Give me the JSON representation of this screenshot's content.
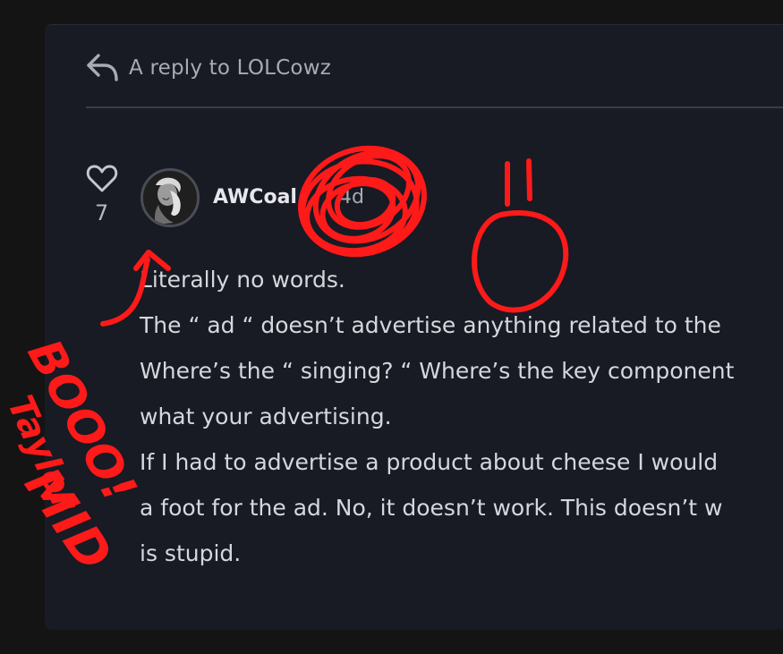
{
  "reply_header": {
    "text": "A reply to LOLCowz",
    "icon": "reply-arrow-icon"
  },
  "post": {
    "likes": "7",
    "like_icon": "heart-icon",
    "author": "AWCoal",
    "separator": "·",
    "time": "4d",
    "body_lines": [
      "Literally no words.",
      "The “ ad “ doesn’t advertise anything related to the",
      "Where’s the “ singing? “ Where’s the key component",
      "what your advertising.",
      "If I had to advertise a product about cheese I would",
      "a foot for the ad. No, it doesn’t work. This doesn’t w",
      "is stupid."
    ]
  },
  "annotations": {
    "color": "#ff1a1a",
    "handwriting": [
      "BOOO!",
      "Taylor",
      "MID"
    ]
  }
}
